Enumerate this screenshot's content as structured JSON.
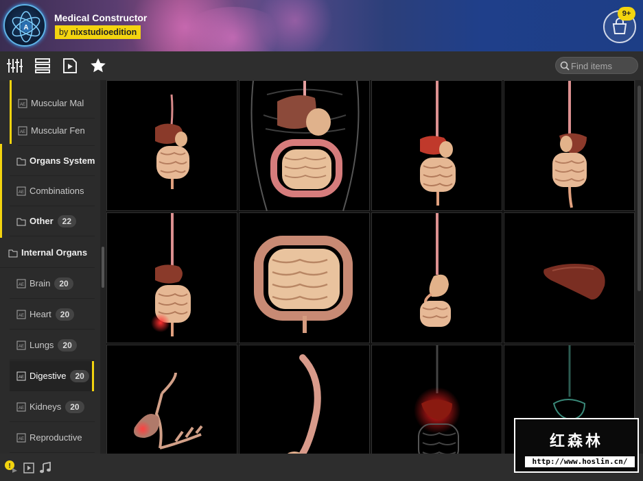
{
  "app": {
    "title": "Medical Constructor",
    "author_prefix": "by",
    "author": "nixstudioedition",
    "cart_badge": "9+"
  },
  "toolbar": {
    "icons": [
      "sliders-icon",
      "list-view-icon",
      "preview-play-icon",
      "favorites-star-icon"
    ],
    "search_placeholder": "Find items"
  },
  "sidebar": {
    "items": [
      {
        "label": "Muscular Mal",
        "count": ""
      },
      {
        "label": "Muscular Fen",
        "count": ""
      },
      {
        "label": "Organs System",
        "count": ""
      },
      {
        "label": "Combinations",
        "count": ""
      },
      {
        "label": "Other",
        "count": "22"
      },
      {
        "label": "Internal Organs",
        "count": ""
      },
      {
        "label": "Brain",
        "count": "20"
      },
      {
        "label": "Heart",
        "count": "20"
      },
      {
        "label": "Lungs",
        "count": "20"
      },
      {
        "label": "Digestive",
        "count": "20"
      },
      {
        "label": "Kidneys",
        "count": "20"
      },
      {
        "label": "Reproductive",
        "count": ""
      }
    ],
    "active_item": "Digestive"
  },
  "grid": {
    "thumbnails": [
      "digestive-system-thumbnail",
      "digestive-in-body-thumbnail",
      "digestive-system-thumbnail",
      "digestive-system-side-thumbnail",
      "digestive-highlight-thumbnail",
      "intestines-thumbnail",
      "stomach-intestine-thumbnail",
      "liver-thumbnail",
      "gallbladder-thumbnail",
      "esophagus-thumbnail",
      "digestive-xray-red-thumbnail",
      "digestive-xray-green-thumbnail"
    ]
  },
  "watermark": {
    "chinese": "红森林",
    "url": "http://www.hoslin.cn/"
  },
  "colors": {
    "accent": "#f3d40f",
    "background": "#2b2b2b",
    "grid_bg": "#000000"
  }
}
